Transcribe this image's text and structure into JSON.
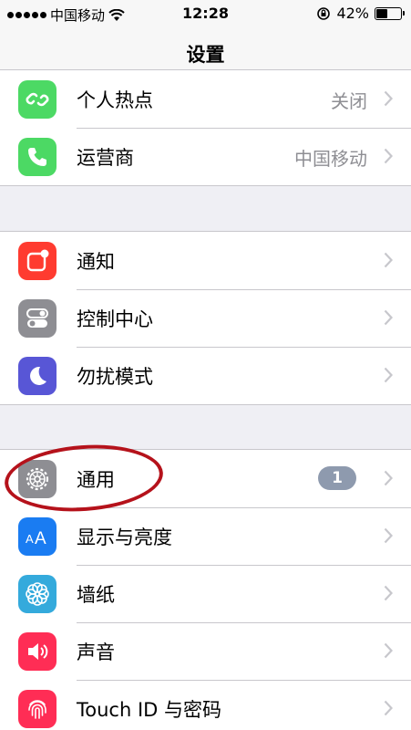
{
  "status_bar": {
    "carrier": "中国移动",
    "time": "12:28",
    "battery_percent": "42%",
    "battery_level": 0.42,
    "icons": [
      "signal-dots",
      "wifi-icon",
      "rotation-lock-icon",
      "battery-icon"
    ]
  },
  "nav": {
    "title": "设置"
  },
  "groups": [
    {
      "rows": [
        {
          "label": "个人热点",
          "value": "关闭",
          "icon": "hotspot-icon",
          "color": "#4cd964"
        },
        {
          "label": "运营商",
          "value": "中国移动",
          "icon": "phone-icon",
          "color": "#4cd964"
        }
      ]
    },
    {
      "rows": [
        {
          "label": "通知",
          "icon": "notifications-icon",
          "color": "#ff3b30"
        },
        {
          "label": "控制中心",
          "icon": "control-center-icon",
          "color": "#8e8e93"
        },
        {
          "label": "勿扰模式",
          "icon": "moon-icon",
          "color": "#5856d6"
        }
      ]
    },
    {
      "rows": [
        {
          "label": "通用",
          "badge": "1",
          "icon": "gear-icon",
          "color": "#8e8e93"
        },
        {
          "label": "显示与亮度",
          "icon": "display-brightness-icon",
          "color": "#1a7cf2"
        },
        {
          "label": "墙纸",
          "icon": "wallpaper-icon",
          "color": "#34aadc"
        },
        {
          "label": "声音",
          "icon": "sound-icon",
          "color": "#ff2d55"
        },
        {
          "label": "Touch ID 与密码",
          "icon": "fingerprint-icon",
          "color": "#ff2d55"
        }
      ]
    }
  ],
  "annotation": {
    "color": "#b5121b"
  }
}
